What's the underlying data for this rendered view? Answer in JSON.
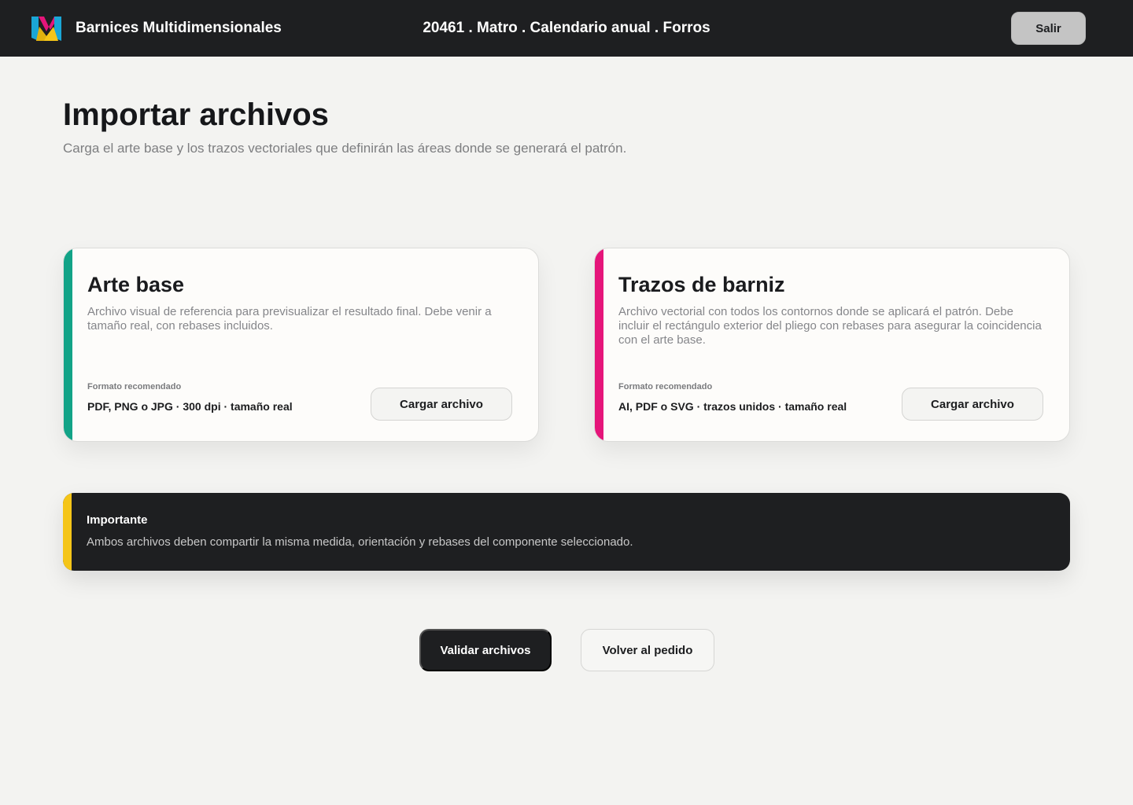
{
  "header": {
    "brand": "Barnices Multidimensionales",
    "breadcrumb": "20461 . Matro . Calendario anual . Forros",
    "exit_label": "Salir"
  },
  "page": {
    "title": "Importar archivos",
    "subtitle": "Carga el arte base y los trazos vectoriales que definirán las áreas donde se generará el patrón."
  },
  "cards": [
    {
      "title": "Arte base",
      "description": "Archivo visual de referencia para previsualizar el resultado final. Debe venir a tamaño real, con rebases incluidos.",
      "format_label": "Formato recomendado",
      "format_value": "PDF, PNG o JPG · 300 dpi · tamaño real",
      "button_label": "Cargar archivo",
      "accent": "#12a387"
    },
    {
      "title": "Trazos de barniz",
      "description": "Archivo vectorial con todos los contornos donde se aplicará el patrón. Debe incluir el rectángulo exterior del pliego con rebases para asegurar la coincidencia con el arte base.",
      "format_label": "Formato recomendado",
      "format_value": "AI, PDF o SVG · trazos unidos · tamaño real",
      "button_label": "Cargar archivo",
      "accent": "#e5157a"
    }
  ],
  "notice": {
    "title": "Importante",
    "text": "Ambos archivos deben compartir la misma medida, orientación y rebases del componente seleccionado.",
    "accent": "#f5c518"
  },
  "actions": {
    "validate_label": "Validar archivos",
    "back_label": "Volver al pedido"
  },
  "colors": {
    "header_bg": "#1e1f21",
    "page_bg": "#f3f3f1",
    "logo_cyan": "#1aa6d6",
    "logo_magenta": "#e5157a",
    "logo_yellow": "#f5c518"
  }
}
